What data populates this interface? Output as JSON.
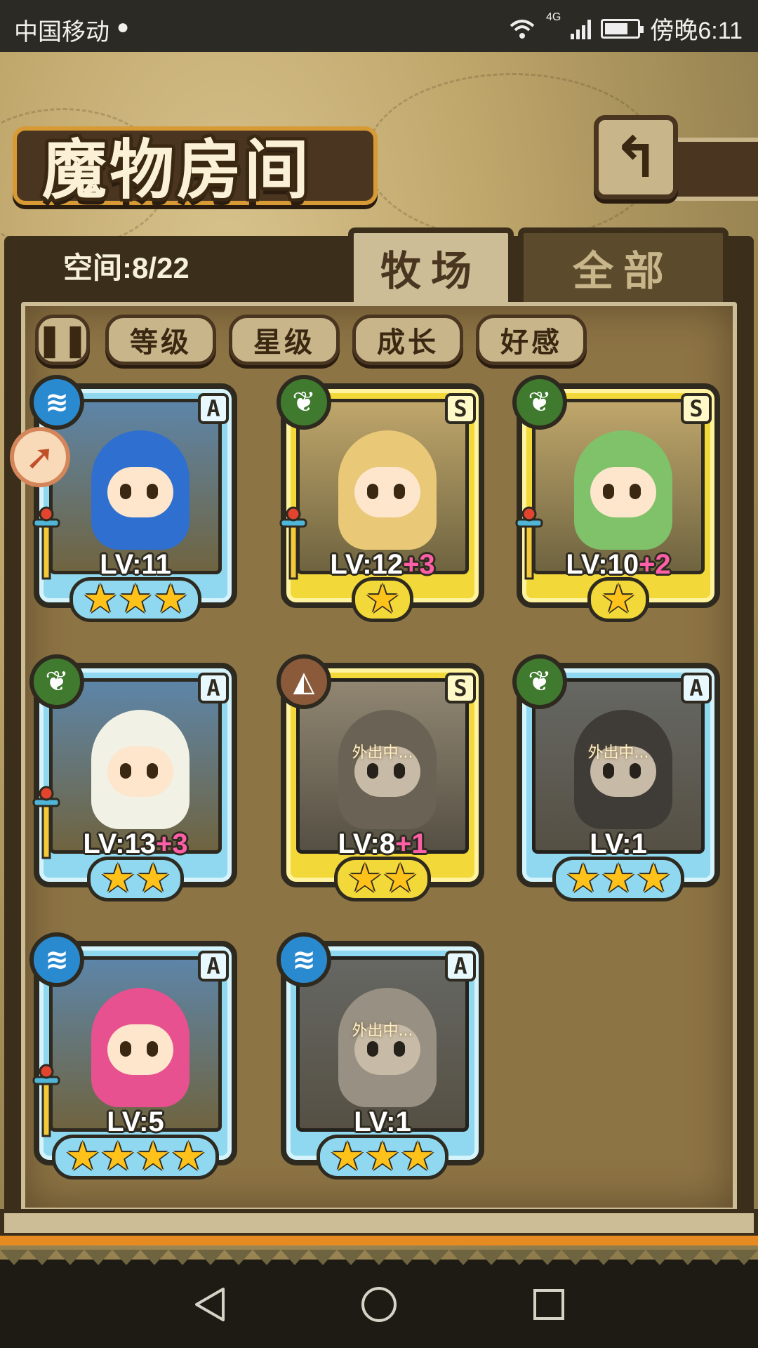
{
  "status_bar": {
    "carrier": "中国移动",
    "wechat_icon": "wechat-icon",
    "network": "4G",
    "time": "傍晚6:11"
  },
  "header": {
    "title": "魔物房间",
    "back_icon": "back-arrow-icon"
  },
  "panel": {
    "capacity": "空间:8/22",
    "tabs": [
      {
        "label": "牧场",
        "active": true
      },
      {
        "label": "全部",
        "active": false
      }
    ],
    "sort_toggle_icon": "sort-toggle-icon",
    "sort_buttons": [
      "等级",
      "星级",
      "成长",
      "好感"
    ]
  },
  "monsters": [
    {
      "rank": "A",
      "element": "water",
      "level": "LV:11",
      "bonus": "",
      "stars": 3,
      "status": "",
      "weapon": true,
      "art_color": "#2f6fd0"
    },
    {
      "rank": "S",
      "element": "leaf",
      "level": "LV:12",
      "bonus": "+3",
      "stars": 1,
      "status": "",
      "weapon": true,
      "art_color": "#e9c877"
    },
    {
      "rank": "S",
      "element": "leaf",
      "level": "LV:10",
      "bonus": "+2",
      "stars": 1,
      "status": "",
      "weapon": true,
      "art_color": "#7fc26a"
    },
    {
      "rank": "A",
      "element": "leaf",
      "level": "LV:13",
      "bonus": "+3",
      "stars": 2,
      "status": "",
      "weapon": true,
      "art_color": "#f2f1e6"
    },
    {
      "rank": "S",
      "element": "earth",
      "level": "LV:8",
      "bonus": "+1",
      "stars": 2,
      "status": "外出中...",
      "weapon": false,
      "art_color": "#8c7a55"
    },
    {
      "rank": "A",
      "element": "leaf",
      "level": "LV:1",
      "bonus": "",
      "stars": 3,
      "status": "外出中...",
      "weapon": false,
      "art_color": "#4a4a55"
    },
    {
      "rank": "A",
      "element": "water",
      "level": "LV:5",
      "bonus": "",
      "stars": 4,
      "status": "",
      "weapon": true,
      "art_color": "#e8518f"
    },
    {
      "rank": "A",
      "element": "water",
      "level": "LV:1",
      "bonus": "",
      "stars": 3,
      "status": "外出中...",
      "weapon": false,
      "art_color": "#b9b3a8"
    }
  ],
  "navbar": {
    "back_icon": "nav-back-icon",
    "home_icon": "nav-home-icon",
    "recents_icon": "nav-recents-icon"
  },
  "colors": {
    "rank_A": "#8fd8f0",
    "rank_S": "#f3d83a",
    "bonus": "#ff5fa6",
    "panel_dark": "#3b2f1c",
    "accent_orange": "#e58b22"
  }
}
